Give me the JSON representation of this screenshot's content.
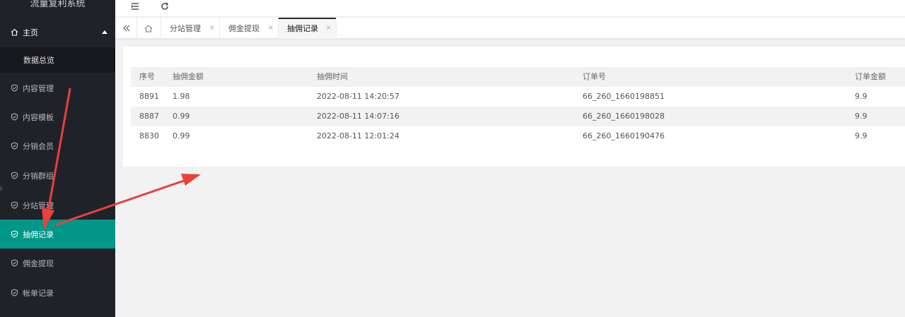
{
  "app": {
    "title": "流量复利系统"
  },
  "sidebar": {
    "home": {
      "label": "主页"
    },
    "sub_items": [
      {
        "label": "数据总览"
      }
    ],
    "items": [
      {
        "label": "内容管理",
        "icon": "shield-check-icon"
      },
      {
        "label": "内容模板",
        "icon": "shield-check-icon"
      },
      {
        "label": "分销会员",
        "icon": "shield-check-icon"
      },
      {
        "label": "分销群组",
        "icon": "shield-check-icon"
      },
      {
        "label": "分站管理",
        "icon": "shield-check-icon"
      },
      {
        "label": "抽佣记录",
        "icon": "shield-check-icon",
        "active": true
      },
      {
        "label": "佣金提现",
        "icon": "shield-check-icon"
      },
      {
        "label": "帐单记录",
        "icon": "shield-check-icon"
      }
    ]
  },
  "header": {
    "icons": [
      "menu-collapse-icon",
      "refresh-icon"
    ]
  },
  "tabs": [
    {
      "label": "分站管理",
      "close": "×"
    },
    {
      "label": "佣金提现",
      "close": "×"
    },
    {
      "label": "抽佣记录",
      "close": "×",
      "active": true
    }
  ],
  "table": {
    "columns": [
      "序号",
      "抽佣金额",
      "抽佣时间",
      "订单号",
      "订单金额"
    ],
    "rows": [
      [
        "8891",
        "1.98",
        "2022-08-11 14:20:57",
        "66_260_1660198851",
        "9.9"
      ],
      [
        "8887",
        "0.99",
        "2022-08-11 14:07:16",
        "66_260_1660198028",
        "9.9"
      ],
      [
        "8830",
        "0.99",
        "2022-08-11 12:01:24",
        "66_260_1660190476",
        "9.9"
      ]
    ]
  },
  "colors": {
    "sidebar_bg": "#20222a",
    "active_item": "#009688",
    "annotation_arrow": "#e8413b"
  }
}
